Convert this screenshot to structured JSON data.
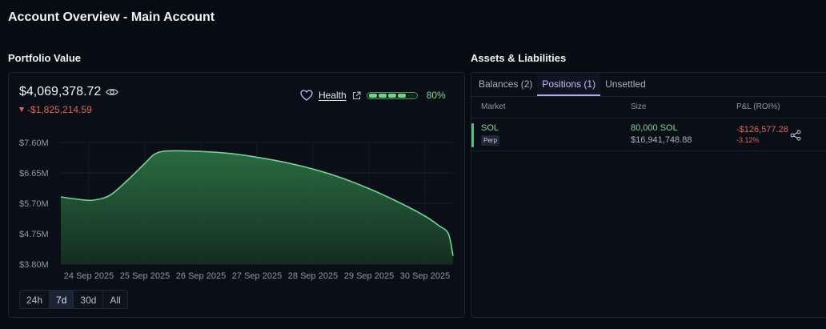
{
  "page": {
    "title": "Account Overview - Main Account"
  },
  "portfolio": {
    "section_title": "Portfolio Value",
    "value": "$4,069,378.72",
    "change": "-$1,825,214.59",
    "health_label": "Health",
    "health_percent_text": "80%",
    "health_fraction": 0.8,
    "ranges": [
      "24h",
      "7d",
      "30d",
      "All"
    ],
    "active_range": "7d"
  },
  "chart_data": {
    "type": "area",
    "title": "",
    "xlabel": "",
    "ylabel": "",
    "ylim": [
      3.8,
      7.6
    ],
    "y_ticks": [
      "$7.60M",
      "$6.65M",
      "$5.70M",
      "$4.75M",
      "$3.80M"
    ],
    "y_tick_values": [
      7.6,
      6.65,
      5.7,
      4.75,
      3.8
    ],
    "x_ticks": [
      "24 Sep 2025",
      "25 Sep 2025",
      "26 Sep 2025",
      "27 Sep 2025",
      "28 Sep 2025",
      "29 Sep 2025",
      "30 Sep 2025"
    ],
    "x_start": "2025-09-23T12:00",
    "x_end": "2025-09-30T12:00",
    "grid": true,
    "color": "#6fd492",
    "series": [
      {
        "points": [
          [
            "2025-09-23T12:00",
            5.9
          ],
          [
            "2025-09-23T20:00",
            5.82
          ],
          [
            "2025-09-24T02:00",
            5.8
          ],
          [
            "2025-09-24T09:00",
            5.95
          ],
          [
            "2025-09-24T17:00",
            6.45
          ],
          [
            "2025-09-25T00:00",
            6.95
          ],
          [
            "2025-09-25T05:00",
            7.27
          ],
          [
            "2025-09-25T12:00",
            7.34
          ],
          [
            "2025-09-26T00:00",
            7.32
          ],
          [
            "2025-09-26T12:00",
            7.26
          ],
          [
            "2025-09-27T00:00",
            7.14
          ],
          [
            "2025-09-27T12:00",
            6.98
          ],
          [
            "2025-09-28T00:00",
            6.77
          ],
          [
            "2025-09-28T12:00",
            6.5
          ],
          [
            "2025-09-29T00:00",
            6.16
          ],
          [
            "2025-09-29T12:00",
            5.76
          ],
          [
            "2025-09-30T00:00",
            5.3
          ],
          [
            "2025-09-30T06:00",
            5.0
          ],
          [
            "2025-09-30T10:00",
            4.75
          ],
          [
            "2025-09-30T12:00",
            4.06
          ]
        ]
      }
    ]
  },
  "assets": {
    "section_title": "Assets & Liabilities",
    "tabs": [
      {
        "label": "Balances (2)",
        "active": false
      },
      {
        "label": "Positions (1)",
        "active": true
      },
      {
        "label": "Unsettled",
        "active": false
      }
    ],
    "columns": {
      "market": "Market",
      "size": "Size",
      "pnl": "P&L (ROI%)"
    },
    "positions": [
      {
        "market": "SOL",
        "badge": "Perp",
        "size": "80,000 SOL",
        "notional": "$16,941,748.88",
        "pnl": "-$126,577.28",
        "roi": "-3.12%"
      }
    ]
  }
}
